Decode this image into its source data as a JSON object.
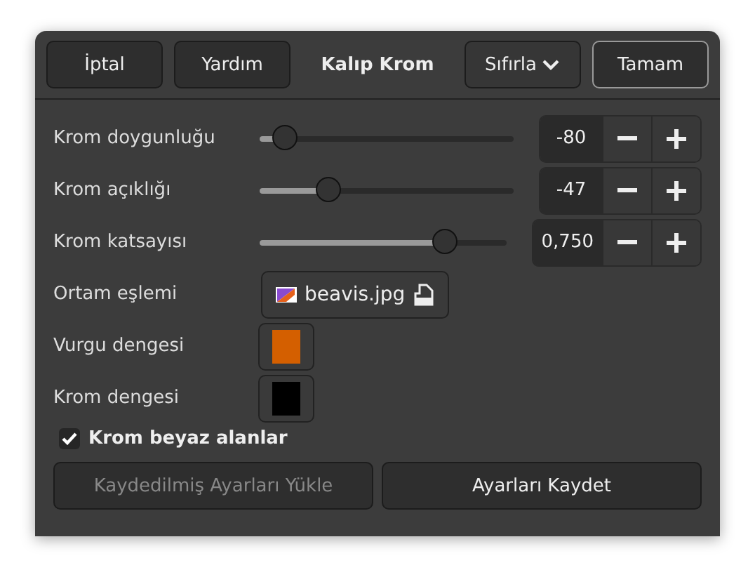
{
  "header": {
    "buttons": [
      {
        "label": "İptal"
      },
      {
        "label": "Yardım"
      }
    ],
    "title": "Kalıp Krom",
    "reset": {
      "label": "Sıfırla"
    },
    "ok": {
      "label": "Tamam"
    }
  },
  "rows": [
    {
      "kind": "slider",
      "label": "Krom doygunluğu",
      "level": 0.1,
      "value": "-80"
    },
    {
      "kind": "slider",
      "label": "Krom açıklığı",
      "level": 0.27,
      "value": "-47"
    },
    {
      "kind": "slider",
      "label": "Krom katsayısı",
      "level": 0.75,
      "value": "0,750"
    },
    {
      "kind": "file",
      "label": "Ortam eşlemi",
      "file": "beavis.jpg"
    },
    {
      "kind": "color",
      "label": "Vurgu dengesi",
      "color": "#d45f00"
    },
    {
      "kind": "color",
      "label": "Krom dengesi",
      "color": "#000000"
    }
  ],
  "checkbox": {
    "label": "Krom beyaz alanlar",
    "checked": true
  },
  "footer": [
    {
      "label": "Kaydedilmiş Ayarları Yükle",
      "disabled": true
    },
    {
      "label": "Ayarları Kaydet",
      "disabled": false
    }
  ]
}
